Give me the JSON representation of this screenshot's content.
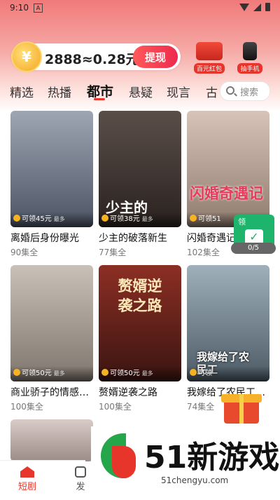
{
  "status_bar": {
    "time": "9:10",
    "notif_icon": "A"
  },
  "coins": {
    "amount_text": "2888≈0.28元",
    "withdraw_label": "提现",
    "coin_glyph": "¥"
  },
  "promos": [
    {
      "label": "百元红包",
      "icon": "red-envelope-icon",
      "color": "#e8352b"
    },
    {
      "label": "抽手机",
      "icon": "phone-icon",
      "color": "#333333"
    }
  ],
  "tabs": [
    "精选",
    "热播",
    "都市",
    "悬疑",
    "现言",
    "古"
  ],
  "active_tab": "都市",
  "search": {
    "placeholder": "搜索"
  },
  "dramas": [
    {
      "title": "离婚后身份曝光",
      "episodes": "90集全",
      "reward": "可领45元",
      "reward_note": "最多",
      "poster_color": "#6d7584",
      "poster_text": ""
    },
    {
      "title": "少主的破落新生",
      "episodes": "77集全",
      "reward": "可领38元",
      "reward_note": "最多",
      "poster_color": "#3d3430",
      "poster_text": "少主的"
    },
    {
      "title": "闪婚奇遇记",
      "episodes": "102集全",
      "reward": "可领51",
      "reward_note": "",
      "poster_color": "#b39a8c",
      "poster_text": "闪婚奇遇记"
    },
    {
      "title": "商业骄子的情感…",
      "episodes": "100集全",
      "reward": "可领50元",
      "reward_note": "最多",
      "poster_color": "#a79d94",
      "poster_text": ""
    },
    {
      "title": "赘婿逆袭之路",
      "episodes": "100集全",
      "reward": "可领50元",
      "reward_note": "最多",
      "poster_color": "#6e2a22",
      "poster_text": "赘婿逆袭之路"
    },
    {
      "title": "我嫁给了农民工…",
      "episodes": "74集全",
      "reward": "可领",
      "reward_note": "",
      "poster_color": "#6a7a86",
      "poster_text": "我嫁给了农民工"
    },
    {
      "title": "",
      "episodes": "",
      "reward": "",
      "reward_note": "",
      "poster_color": "#c9b8b4",
      "poster_text": ""
    }
  ],
  "float_widget": {
    "label": "领",
    "progress": "0/5"
  },
  "bottom_nav": [
    {
      "label": "短剧",
      "active": true
    },
    {
      "label": "发",
      "active": false
    }
  ],
  "watermark": {
    "brand": "51新游戏",
    "url": "51chengyu.com"
  }
}
